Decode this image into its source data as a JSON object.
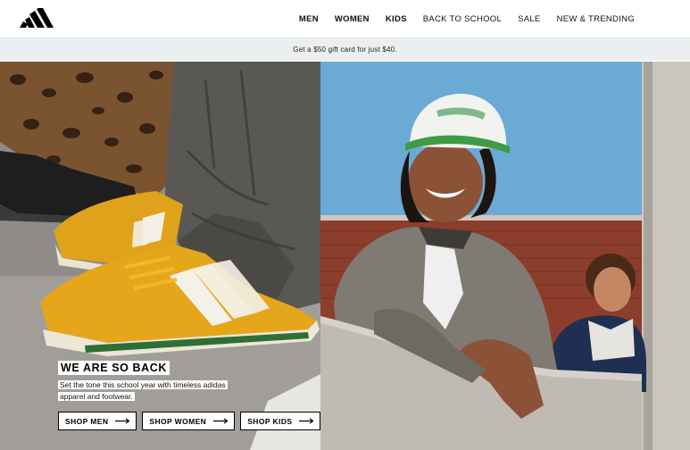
{
  "header": {
    "logo": "adidas-logo",
    "nav": [
      {
        "label": "MEN",
        "bold": true
      },
      {
        "label": "WOMEN",
        "bold": true
      },
      {
        "label": "KIDS",
        "bold": true
      },
      {
        "label": "BACK TO SCHOOL",
        "bold": false
      },
      {
        "label": "SALE",
        "bold": false
      },
      {
        "label": "NEW & TRENDING",
        "bold": false
      }
    ]
  },
  "promo": {
    "text": "Get a $50 gift card for just $40."
  },
  "hero": {
    "left_image": "sneakers-photo",
    "right_image": "students-photo",
    "headline": "WE ARE SO BACK",
    "subline_1": "Set the tone this school year with timeless adidas",
    "subline_2": "apparel and footwear.",
    "ctas": [
      {
        "label": "SHOP MEN",
        "icon": "arrow-right-icon"
      },
      {
        "label": "SHOP WOMEN",
        "icon": "arrow-right-icon"
      },
      {
        "label": "SHOP KIDS",
        "icon": "arrow-right-icon"
      }
    ]
  },
  "colors": {
    "brand": "#000000",
    "promo_bg": "#eceff1",
    "sky": "#5fa1cf"
  }
}
